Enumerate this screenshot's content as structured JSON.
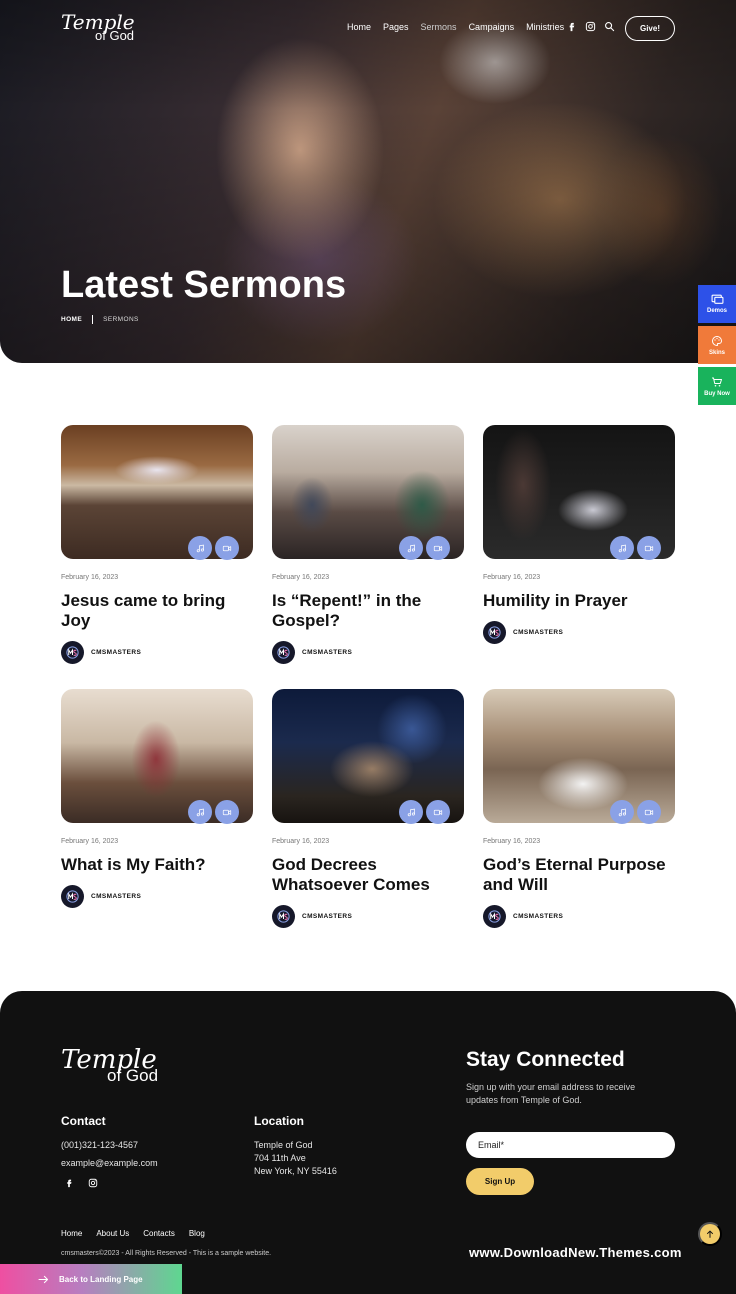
{
  "brand": {
    "logo_line1": "Temple",
    "logo_line2": "of God"
  },
  "nav": {
    "items": [
      "Home",
      "Pages",
      "Sermons",
      "Campaigns",
      "Ministries"
    ],
    "active": "Sermons",
    "give_label": "Give!"
  },
  "icons": {
    "facebook": "facebook-icon",
    "instagram": "instagram-icon",
    "search": "search-icon",
    "music": "music-note-icon",
    "video": "video-camera-icon",
    "arrow_up": "arrow-up-icon",
    "arrow_right": "arrow-right-icon"
  },
  "hero": {
    "title": "Latest Sermons",
    "breadcrumb": {
      "home": "HOME",
      "current": "SERMONS"
    }
  },
  "side_panel": {
    "demos": "Demos",
    "skins": "Skins",
    "buy_now": "Buy Now",
    "colors": {
      "demos": "#2d51e8",
      "skins": "#f07a3a",
      "buy_now": "#19b35c"
    }
  },
  "sermons": [
    {
      "date": "February 16, 2023",
      "title": "Jesus came to bring Joy",
      "author": "CMSMASTERS"
    },
    {
      "date": "February 16, 2023",
      "title": "Is “Repent!” in the Gospel?",
      "author": "CMSMASTERS"
    },
    {
      "date": "February 16, 2023",
      "title": "Humility in Prayer",
      "author": "CMSMASTERS"
    },
    {
      "date": "February 16, 2023",
      "title": "What is My Faith?",
      "author": "CMSMASTERS"
    },
    {
      "date": "February 16, 2023",
      "title": "God Decrees Whatsoever Comes",
      "author": "CMSMASTERS"
    },
    {
      "date": "February 16, 2023",
      "title": "God’s Eternal Purpose and Will",
      "author": "CMSMASTERS"
    }
  ],
  "footer": {
    "contact": {
      "heading": "Contact",
      "phone": "(001)321-123-4567",
      "email": "example@example.com"
    },
    "location": {
      "heading": "Location",
      "line1": "Temple of God",
      "line2": "704 11th Ave",
      "line3": "New York, NY 55416"
    },
    "stay": {
      "title": "Stay Connected",
      "subtitle": "Sign up with your email address to receive updates from Temple of God.",
      "email_placeholder": "Email*",
      "signup_label": "Sign Up"
    },
    "links": [
      "Home",
      "About Us",
      "Contacts",
      "Blog"
    ],
    "copyright": "cmsmasters©2023 - All Rights Reserved - This is a sample website.",
    "watermark": "www.DownloadNew.Themes.com",
    "back_label": "Back to Landing Page",
    "accent_color": "#f2cc6a"
  }
}
